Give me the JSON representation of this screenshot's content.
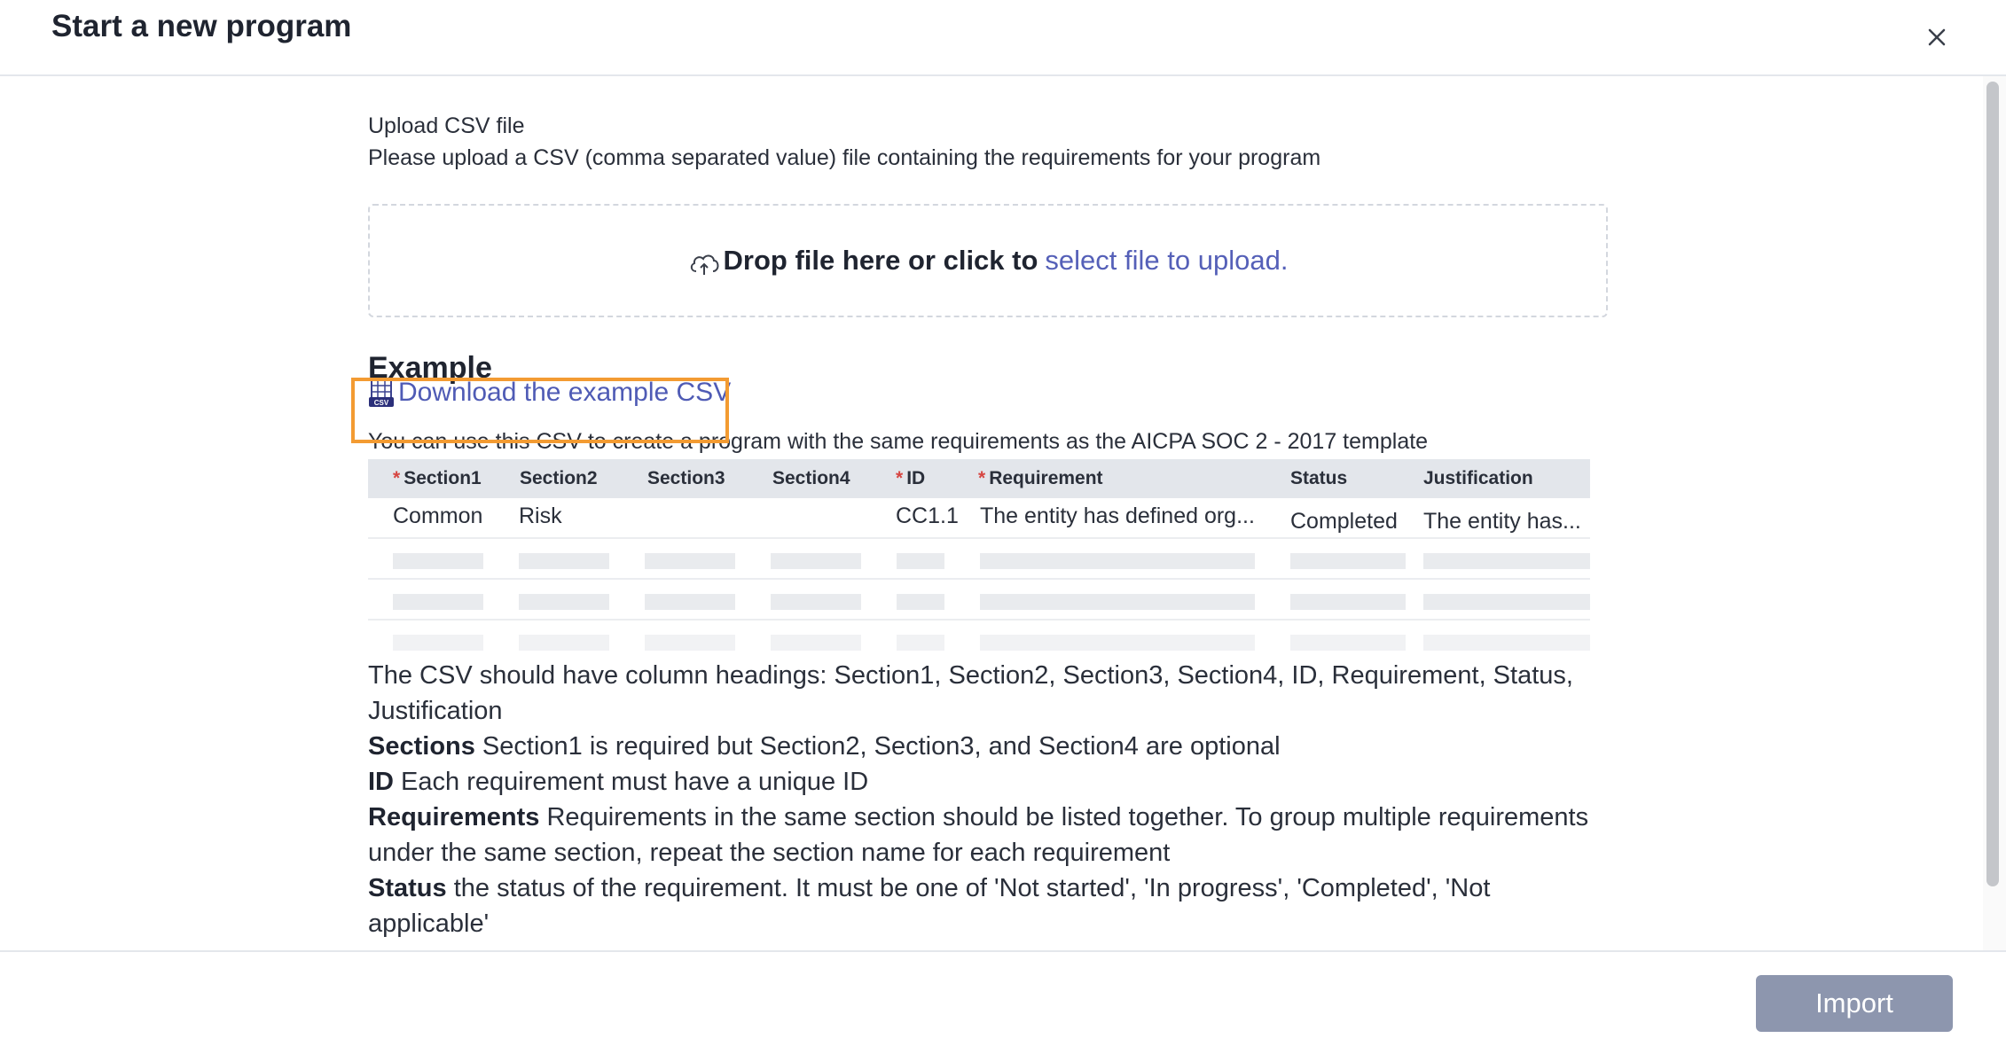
{
  "modal": {
    "title": "Start a new program"
  },
  "upload": {
    "title": "Upload CSV file",
    "description": "Please upload a CSV (comma separated value) file containing the requirements for your program",
    "drop_text": "Drop file here or click to",
    "drop_link": "select file to upload."
  },
  "example": {
    "heading": "Example",
    "download_label": "Download the example CSV",
    "description": "You can use this CSV to create a program with the same requirements as the AICPA SOC 2 - 2017 template",
    "required_mark": "*",
    "columns": [
      "Section1",
      "Section2",
      "Section3",
      "Section4",
      "ID",
      "Requirement",
      "Status",
      "Justification"
    ],
    "row": [
      "Common",
      "Risk",
      "",
      "",
      "CC1.1",
      "The entity has defined org...",
      "Completed",
      "The entity has..."
    ]
  },
  "info": {
    "headings_text": "The CSV should have column headings: Section1, Section2, Section3, Section4, ID, Requirement, Status, Justification",
    "sections_label": "Sections",
    "sections_text": " Section1 is required but Section2, Section3, and Section4 are optional",
    "id_label": "ID",
    "id_text": " Each requirement must have a unique ID",
    "requirements_label": "Requirements",
    "requirements_text": " Requirements in the same section should be listed together. To group multiple requirements under the same section, repeat the section name for each requirement",
    "status_label": "Status",
    "status_text": " the status of the requirement. It must be one of 'Not started', 'In progress', 'Completed', 'Not applicable'"
  },
  "footer": {
    "import_label": "Import"
  },
  "icons": {
    "close": "close-icon",
    "upload": "cloud-upload-icon",
    "csv": "csv-file-icon"
  },
  "colors": {
    "link": "#5560b8",
    "highlight": "#f39b32",
    "required": "#d64541",
    "import_button": "#8d96ae"
  }
}
